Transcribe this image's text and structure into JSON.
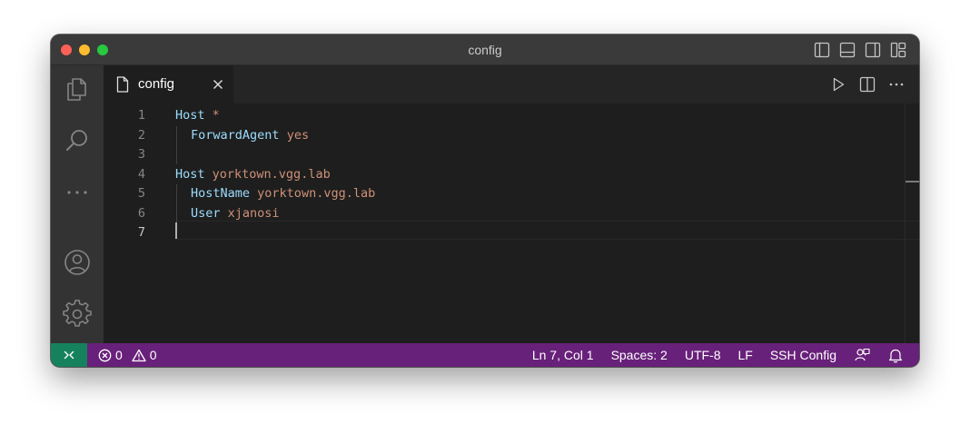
{
  "window": {
    "title": "config"
  },
  "tab": {
    "label": "config",
    "icon": "file-icon"
  },
  "editor": {
    "line_numbers": [
      "1",
      "2",
      "3",
      "4",
      "5",
      "6",
      "7"
    ],
    "active_line": 7,
    "lines": [
      {
        "key": "Host",
        "value": "*",
        "indent": false
      },
      {
        "key": "ForwardAgent",
        "value": "yes",
        "indent": true
      },
      {
        "key": "",
        "value": "",
        "indent": false
      },
      {
        "key": "Host",
        "value": "yorktown.vgg.lab",
        "indent": false
      },
      {
        "key": "HostName",
        "value": "yorktown.vgg.lab",
        "indent": true
      },
      {
        "key": "User",
        "value": "xjanosi",
        "indent": true
      },
      {
        "key": "",
        "value": "",
        "indent": false
      }
    ]
  },
  "status": {
    "errors": "0",
    "warnings": "0",
    "position": "Ln 7, Col 1",
    "spaces": "Spaces: 2",
    "encoding": "UTF-8",
    "eol": "LF",
    "language": "SSH Config"
  },
  "colors": {
    "statusbar": "#68217a",
    "remote_indicator": "#16825d",
    "keyword": "#9cdcfe",
    "value": "#ce9178",
    "editor_bg": "#1e1e1e",
    "activitybar_bg": "#333333"
  }
}
